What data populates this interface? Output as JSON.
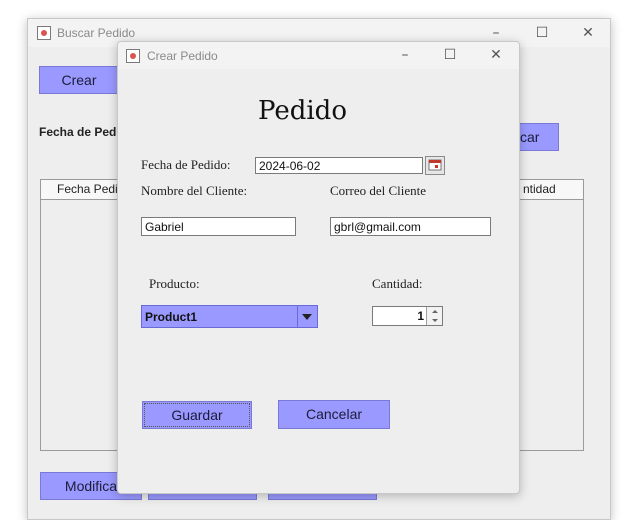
{
  "back_window": {
    "title": "Buscar Pedido",
    "crear_label": "Crear",
    "fecha_label": "Fecha de Pedi",
    "buscar_label": "car",
    "table_headers": [
      "Fecha Pedi",
      "ntidad"
    ],
    "modificar_label": "Modifica"
  },
  "dialog": {
    "title": "Crear Pedido",
    "heading": "Pedido",
    "fecha_label": "Fecha de Pedido:",
    "fecha_value": "2024-06-02",
    "nombre_label": "Nombre del Cliente:",
    "nombre_value": "Gabriel",
    "correo_label": "Correo del Cliente",
    "correo_value": "gbrl@gmail.com",
    "producto_label": "Producto:",
    "producto_value": "Product1",
    "cantidad_label": "Cantidad:",
    "cantidad_value": "1",
    "guardar_label": "Guardar",
    "cancelar_label": "Cancelar"
  },
  "colors": {
    "accent": "#9999ff",
    "window_bg": "#eeeeee"
  },
  "icons": [
    "java-app-icon",
    "minimize-icon",
    "maximize-icon",
    "close-icon",
    "calendar-icon",
    "dropdown-arrow-icon",
    "spinner-up-icon",
    "spinner-down-icon"
  ]
}
